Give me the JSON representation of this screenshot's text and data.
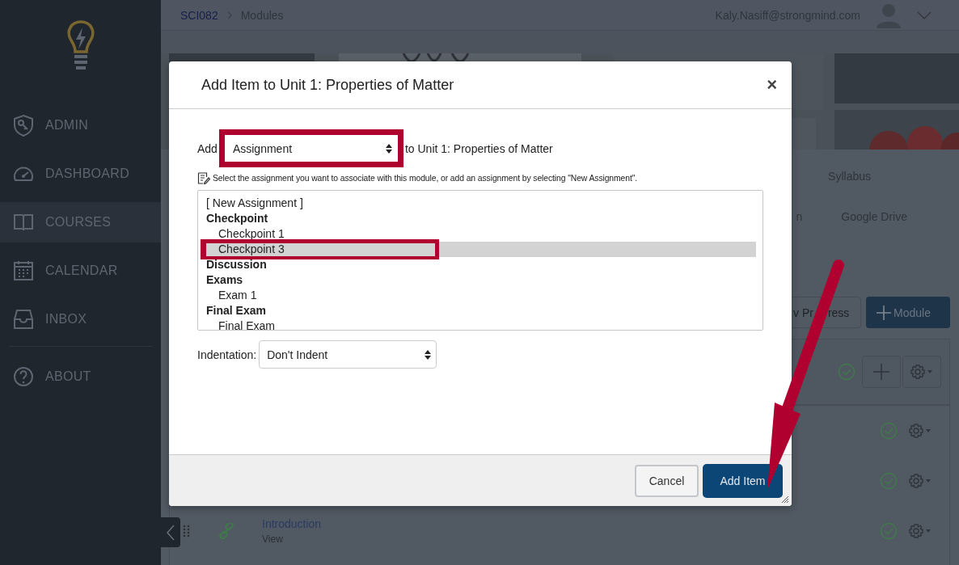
{
  "sidebar": {
    "items": [
      {
        "label": "ADMIN",
        "selected": false
      },
      {
        "label": "DASHBOARD",
        "selected": false
      },
      {
        "label": "COURSES",
        "selected": true
      },
      {
        "label": "CALENDAR",
        "selected": false
      },
      {
        "label": "INBOX",
        "selected": false
      }
    ],
    "footer_items": [
      {
        "label": "ABOUT",
        "selected": false
      }
    ]
  },
  "topbar": {
    "breadcrumbs": [
      {
        "label": "SCI082",
        "kind": "link"
      },
      {
        "label": "Modules",
        "kind": "current"
      }
    ],
    "user_email": "Kaly.Nasiff@strongmind.com"
  },
  "course_tabs": [
    [
      {
        "label": "Syllabus"
      }
    ],
    [
      {
        "label": "n"
      },
      {
        "label": "Google Drive"
      }
    ]
  ],
  "toolbar": [
    {
      "label_parts": [
        "v Pr",
        "ress"
      ],
      "kind": "outline"
    },
    {
      "label": "Module",
      "kind": "primary"
    }
  ],
  "modules": {
    "header": {
      "published": true
    },
    "items": [
      {
        "published": true
      },
      {
        "published": true
      },
      {
        "title": "Introduction",
        "subtitle": "View",
        "published": true
      }
    ]
  },
  "modal": {
    "title": "Add Item to Unit 1: Properties of Matter",
    "close": "×",
    "add_label": "Add",
    "type_select": {
      "value": "Assignment",
      "highlighted": true
    },
    "add_suffix": "to Unit 1: Properties of Matter",
    "hint": "Select the assignment you want to associate with this module, or add an assignment by selecting \"New Assignment\".",
    "options": [
      {
        "kind": "option",
        "label": "[ New Assignment ]",
        "selected": false,
        "highlighted": false
      },
      {
        "kind": "group",
        "label": "Checkpoint",
        "children": [
          {
            "label": "Checkpoint 1",
            "selected": false,
            "highlighted": false
          },
          {
            "label": "Checkpoint 3",
            "selected": true,
            "highlighted": true
          }
        ]
      },
      {
        "kind": "group",
        "label": "Discussion"
      },
      {
        "kind": "group",
        "label": "Exams",
        "children": [
          {
            "label": "Exam 1",
            "selected": false,
            "highlighted": false
          }
        ]
      },
      {
        "kind": "group",
        "label": "Final Exam",
        "children": [
          {
            "label": "Final Exam",
            "selected": false,
            "highlighted": false
          }
        ]
      }
    ],
    "indentation": {
      "label": "Indentation:",
      "value": "Don't Indent"
    },
    "buttons": [
      {
        "label": "Cancel",
        "kind": "secondary"
      },
      {
        "label": "Add Item",
        "kind": "primary",
        "pointed": true
      }
    ]
  }
}
